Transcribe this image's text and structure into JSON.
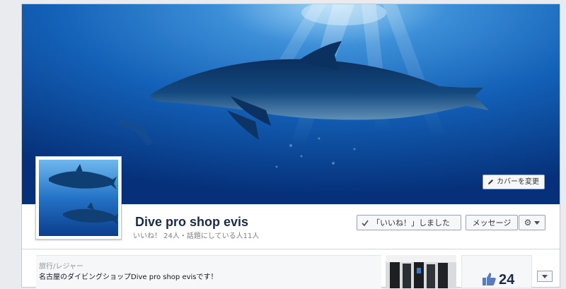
{
  "cover": {
    "change_cover_label": "カバーを変更"
  },
  "page": {
    "name": "Dive pro shop evis",
    "stats": "いいね！ 24人・話題にしている人11人"
  },
  "actions": {
    "liked_label": "「いいね！」しました",
    "message_label": "メッセージ"
  },
  "about": {
    "category": "旅行/レジャー",
    "description": "名古屋のダイビングショップDive pro shop evisです！"
  },
  "likes": {
    "count": "24"
  },
  "colors": {
    "ocean_dark": "#062f73",
    "ocean_mid": "#1160b7",
    "ocean_light": "#6fb8ee",
    "name_text": "#1c2a47",
    "link_blue": "#3b5998"
  }
}
